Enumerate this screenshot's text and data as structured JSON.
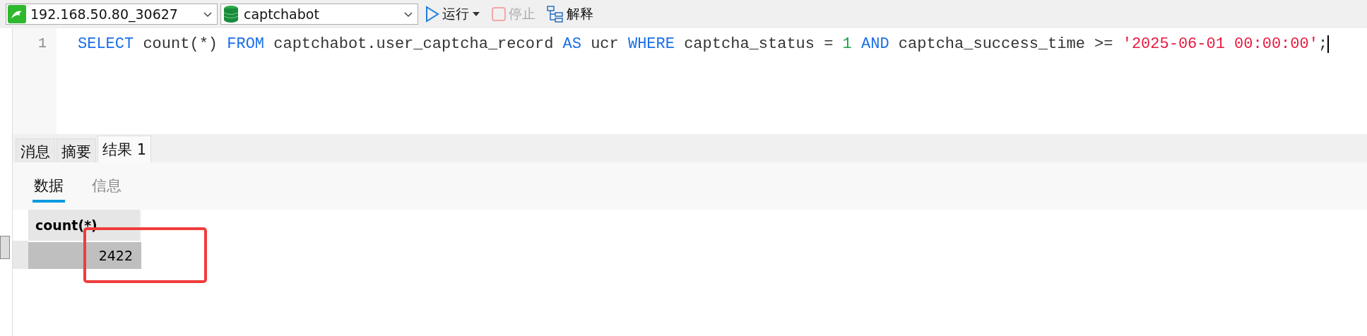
{
  "toolbar": {
    "connection": "192.168.50.80_30627",
    "database": "captchabot",
    "run": {
      "label": "运行",
      "disabled": false
    },
    "stop": {
      "label": "停止",
      "disabled": true
    },
    "explain": {
      "label": "解释",
      "disabled": false
    }
  },
  "editor": {
    "lines": [
      {
        "number": "1",
        "tokens": [
          {
            "kind": "keyword",
            "text": "SELECT"
          },
          {
            "kind": "plain",
            "text": " count(*) "
          },
          {
            "kind": "keyword",
            "text": "FROM"
          },
          {
            "kind": "plain",
            "text": " captchabot.user_captcha_record "
          },
          {
            "kind": "keyword",
            "text": "AS"
          },
          {
            "kind": "plain",
            "text": " ucr "
          },
          {
            "kind": "keyword",
            "text": "WHERE"
          },
          {
            "kind": "plain",
            "text": " captcha_status = "
          },
          {
            "kind": "number",
            "text": "1"
          },
          {
            "kind": "keyword",
            "text": " AND"
          },
          {
            "kind": "plain",
            "text": " captcha_success_time >= "
          },
          {
            "kind": "string",
            "text": "'2025-06-01 00:00:00'"
          },
          {
            "kind": "plain",
            "text": ";"
          }
        ]
      }
    ]
  },
  "result_tabs": [
    {
      "label": "消息",
      "selected": false
    },
    {
      "label": "摘要",
      "selected": false
    },
    {
      "label": "结果 1",
      "selected": true
    }
  ],
  "sub_tabs": [
    {
      "label": "数据",
      "selected": true
    },
    {
      "label": "信息",
      "selected": false
    }
  ],
  "grid": {
    "columns": [
      "count(*)"
    ],
    "rows": [
      {
        "selected": true,
        "cells": [
          "2422"
        ]
      }
    ]
  }
}
